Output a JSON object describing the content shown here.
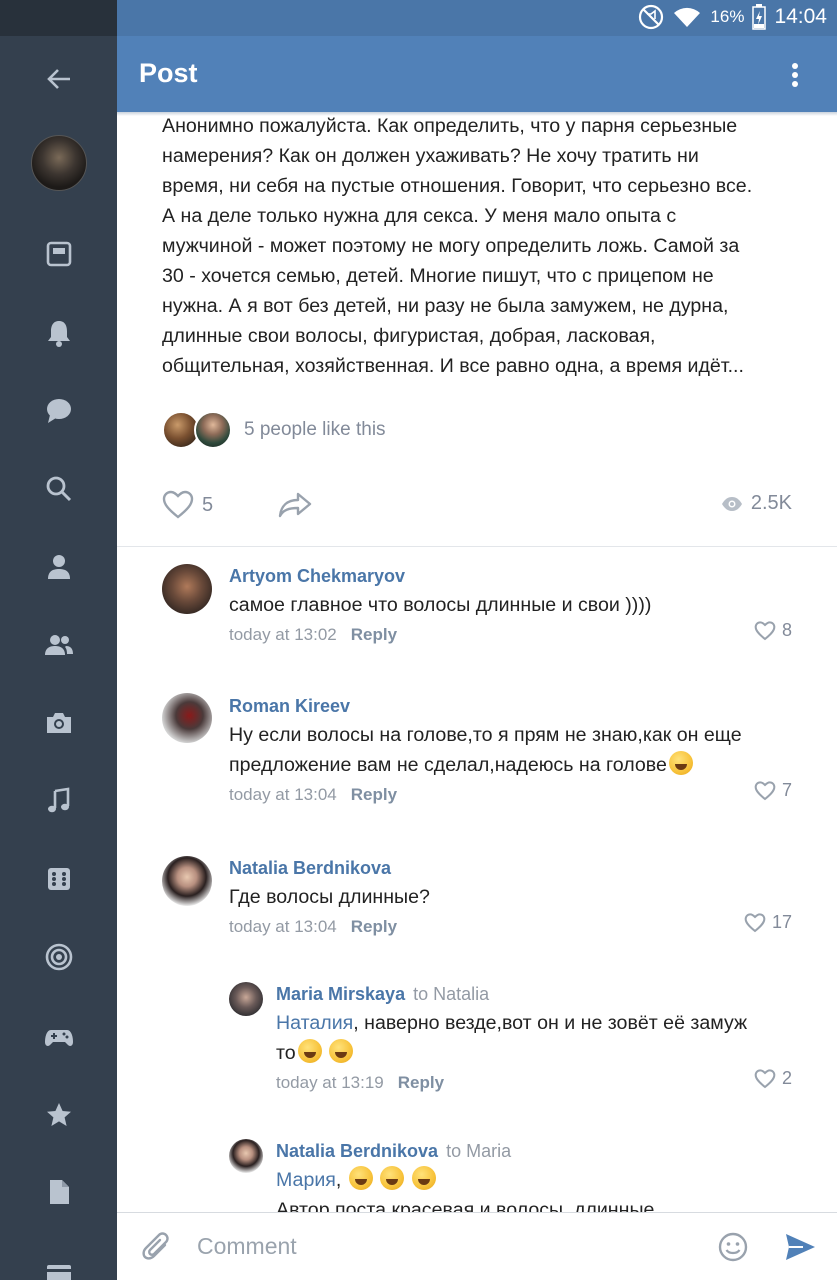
{
  "status": {
    "battery": "16%",
    "time": "14:04"
  },
  "header": {
    "title": "Post"
  },
  "sidebar": {
    "items": [
      {
        "name": "back-arrow-icon"
      },
      {
        "name": "profile-avatar"
      },
      {
        "name": "news-icon"
      },
      {
        "name": "notifications-bell-icon"
      },
      {
        "name": "messages-icon"
      },
      {
        "name": "search-icon"
      },
      {
        "name": "friends-icon"
      },
      {
        "name": "communities-icon"
      },
      {
        "name": "photos-camera-icon"
      },
      {
        "name": "music-icon"
      },
      {
        "name": "games-icon"
      },
      {
        "name": "target-icon"
      },
      {
        "name": "gamepad-icon"
      },
      {
        "name": "favorites-star-icon"
      },
      {
        "name": "documents-icon"
      },
      {
        "name": "payments-card-icon"
      }
    ]
  },
  "post": {
    "text_lines": [
      "Анонимно пожалуйста. Как определить, что у парня серьезные",
      "намерения? Как он должен ухаживать? Не хочу тратить ни",
      "время, ни себя на пустые отношения. Говорит, что серьезно все.",
      "А на деле только нужна для секса. У меня мало опыта с",
      "мужчиной - может поэтому не могу определить ложь. Самой за",
      "30 - хочется семью, детей. Многие пишут, что с прицепом не",
      "нужна. А я вот без детей, ни разу не была замужем, не дурна,",
      "длинные свои волосы, фигуристая, добрая, ласковая,",
      "общительная, хозяйственная. И все равно одна, а время идёт..."
    ],
    "likes_text": "5 people like this",
    "like_count": "5",
    "views": "2.5K"
  },
  "comments": [
    {
      "author": "Artyom Chekmaryov",
      "text": "самое главное что волосы длинные и свои ))))",
      "time": "today at 13:02",
      "reply_label": "Reply",
      "likes": "8"
    },
    {
      "author": "Roman Kireev",
      "text_line1": "Ну если волосы на голове,то я прям не знаю,как он еще",
      "text_line2": "предложение вам не сделал,надеюсь на голове",
      "time": "today at 13:04",
      "reply_label": "Reply",
      "likes": "7"
    },
    {
      "author": "Natalia Berdnikova",
      "text": "Где волосы длинные?",
      "time": "today at 13:04",
      "reply_label": "Reply",
      "likes": "17"
    },
    {
      "author": "Maria Mirskaya",
      "to": "to Natalia",
      "mention": "Наталия",
      "text_line1": ", наверно везде,вот он и не зовёт её замуж",
      "text_line2": "то",
      "time": "today at 13:19",
      "reply_label": "Reply",
      "likes": "2"
    },
    {
      "author": "Natalia Berdnikova",
      "to": "to Maria",
      "mention": "Мария",
      "text_suffix": ",",
      "text_line2": "Автор поста красевая и волосы, длинные"
    }
  ],
  "composer": {
    "placeholder": "Comment"
  }
}
